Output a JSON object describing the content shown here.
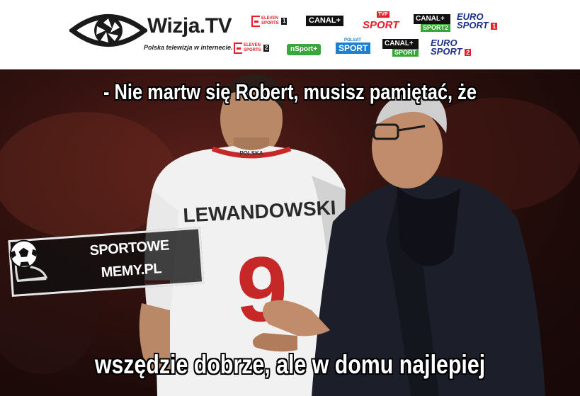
{
  "banner": {
    "brand_name": "Wizja.TV",
    "tagline": "Polska telewizja w internecie.",
    "channels": {
      "eleven1": {
        "label": "ELEVEN SPORTS",
        "num": "1"
      },
      "eleven2": {
        "label": "ELEVEN SPORTS",
        "num": "2"
      },
      "canal_plus": "CANAL+",
      "tvp_sport": {
        "badge": "TVP",
        "label": "SPORT"
      },
      "canal_sport2": {
        "top": "CANAL+",
        "bottom": "SPORT2"
      },
      "canal_sport": {
        "top": "CANAL+",
        "bottom": "SPORT"
      },
      "eurosport1": {
        "line1": "EURO",
        "line2": "SPORT",
        "num": "1"
      },
      "eurosport2": {
        "line1": "EURO",
        "line2": "SPORT",
        "num": "2"
      },
      "nsport": "nSport+",
      "polsat_sport": {
        "top": "POLSAT",
        "label": "SPORT"
      }
    }
  },
  "scene": {
    "jersey_name": "LEWANDOWSKI",
    "jersey_number": "9",
    "collar_text": "POLSKA"
  },
  "captions": {
    "top": "- Nie martw się Robert, musisz pamiętać, że",
    "bottom": "wszędzie dobrze, ale w domu najlepiej"
  },
  "watermark": {
    "line1": "SPORTOWE",
    "line2": "MEMY.PL"
  },
  "colors": {
    "red": "#e3202c",
    "green": "#38a538",
    "eurosport_blue": "#1b2f86",
    "polsat_blue": "#1d7fd0"
  },
  "icons": [
    "wizja-eye-logo",
    "soccer-ball-icon",
    "boot-icon"
  ]
}
